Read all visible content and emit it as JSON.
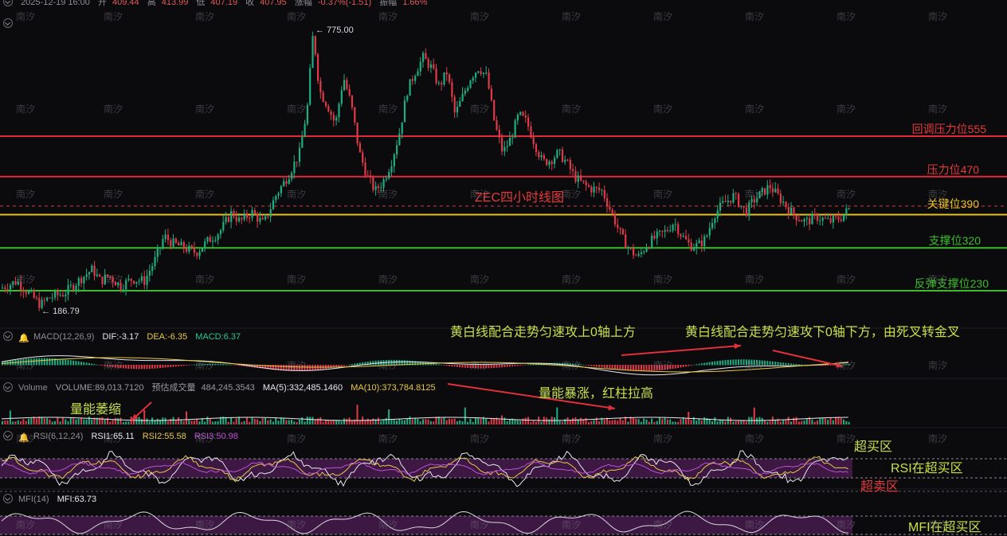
{
  "header": {
    "datetime": "2025-12-19 16:00",
    "open_label": "开",
    "open": "409.44",
    "high_label": "高",
    "high": "413.99",
    "low_label": "低",
    "low": "407.19",
    "close_label": "收",
    "close": "407.95",
    "change_label": "涨幅",
    "change": "-0.37%(-1.51)",
    "amplitude_label": "振幅",
    "amplitude": "1.66%"
  },
  "macd": {
    "title": "MACD(12,26,9)",
    "dif": "DIF:-3.17",
    "dea": "DEA:-6.35",
    "macd": "MACD:6.37"
  },
  "volume": {
    "title": "Volume",
    "value": "VOLUME:89,013.7120",
    "est_label": "预估成交量",
    "est": "484,245.3543",
    "ma5": "MA(5):332,485.1460",
    "ma10": "MA(10):373,784.8125"
  },
  "rsi": {
    "title": "RSI(6,12,24)",
    "rsi1": "RSI1:65.11",
    "rsi2": "RSI2:55.58",
    "rsi3": "RSI3:50.98"
  },
  "mfi": {
    "title": "MFI(14)",
    "mfi": "MFI:63.73"
  },
  "chart_title": "ZEC四小时线图",
  "watermark": "南汐",
  "levels": [
    {
      "label": "回调压力位555",
      "value": 555,
      "color": "#e02a3a"
    },
    {
      "label": "压力位470",
      "value": 470,
      "color": "#e02a3a"
    },
    {
      "label": "关键位390",
      "value": 390,
      "color": "#e8c020"
    },
    {
      "label": "支撑位320",
      "value": 320,
      "color": "#3cbc2a"
    },
    {
      "label": "反弹支撑位230",
      "value": 230,
      "color": "#3cbc2a"
    }
  ],
  "annotations": {
    "macd_up": "黄白线配合走势匀速攻上0轴上方",
    "macd_down": "黄白线配合走势匀速攻下0轴下方，由死叉转金叉",
    "vol_shrink": "量能萎缩",
    "vol_surge": "量能暴涨，红柱拉高",
    "overbought": "超买区",
    "oversold": "超卖区",
    "rsi_ob": "RSI在超买区",
    "mfi_ob": "MFI在超买区"
  },
  "chart_data": {
    "type": "candlestick",
    "title": "ZEC四小时线图",
    "y_range": [
      170,
      830
    ],
    "high_label": "775.00",
    "low_label": "186.79",
    "current_price": 407.95,
    "trend": [
      [
        0,
        235
      ],
      [
        20,
        250
      ],
      [
        35,
        225
      ],
      [
        50,
        200
      ],
      [
        60,
        215
      ],
      [
        80,
        225
      ],
      [
        100,
        255
      ],
      [
        115,
        275
      ],
      [
        125,
        250
      ],
      [
        135,
        262
      ],
      [
        150,
        240
      ],
      [
        165,
        255
      ],
      [
        180,
        250
      ],
      [
        195,
        300
      ],
      [
        205,
        345
      ],
      [
        215,
        330
      ],
      [
        230,
        320
      ],
      [
        245,
        310
      ],
      [
        260,
        335
      ],
      [
        275,
        355
      ],
      [
        290,
        395
      ],
      [
        300,
        375
      ],
      [
        315,
        395
      ],
      [
        330,
        370
      ],
      [
        345,
        430
      ],
      [
        360,
        470
      ],
      [
        375,
        520
      ],
      [
        385,
        620
      ],
      [
        392,
        775
      ],
      [
        400,
        650
      ],
      [
        410,
        620
      ],
      [
        420,
        580
      ],
      [
        430,
        680
      ],
      [
        440,
        620
      ],
      [
        450,
        520
      ],
      [
        460,
        470
      ],
      [
        470,
        440
      ],
      [
        480,
        460
      ],
      [
        490,
        500
      ],
      [
        500,
        560
      ],
      [
        510,
        650
      ],
      [
        520,
        690
      ],
      [
        530,
        720
      ],
      [
        540,
        700
      ],
      [
        550,
        660
      ],
      [
        560,
        690
      ],
      [
        570,
        600
      ],
      [
        580,
        640
      ],
      [
        590,
        680
      ],
      [
        600,
        700
      ],
      [
        610,
        680
      ],
      [
        620,
        580
      ],
      [
        630,
        520
      ],
      [
        640,
        550
      ],
      [
        650,
        600
      ],
      [
        660,
        585
      ],
      [
        670,
        540
      ],
      [
        680,
        500
      ],
      [
        690,
        505
      ],
      [
        700,
        520
      ],
      [
        710,
        500
      ],
      [
        720,
        470
      ],
      [
        730,
        455
      ],
      [
        740,
        445
      ],
      [
        755,
        440
      ],
      [
        770,
        380
      ],
      [
        780,
        340
      ],
      [
        790,
        315
      ],
      [
        800,
        300
      ],
      [
        810,
        325
      ],
      [
        820,
        340
      ],
      [
        835,
        355
      ],
      [
        845,
        375
      ],
      [
        855,
        345
      ],
      [
        865,
        325
      ],
      [
        875,
        325
      ],
      [
        885,
        340
      ],
      [
        895,
        390
      ],
      [
        905,
        410
      ],
      [
        920,
        430
      ],
      [
        935,
        395
      ],
      [
        945,
        420
      ],
      [
        955,
        435
      ],
      [
        965,
        450
      ],
      [
        975,
        430
      ],
      [
        985,
        410
      ],
      [
        995,
        390
      ],
      [
        1010,
        375
      ],
      [
        1025,
        385
      ],
      [
        1040,
        375
      ],
      [
        1055,
        385
      ],
      [
        1068,
        408
      ]
    ],
    "macd_annot_note": "MACD line crosses above zero then below; death cross turns golden cross",
    "rsi_levels": [
      70,
      30
    ],
    "mfi_value": 63.73
  }
}
